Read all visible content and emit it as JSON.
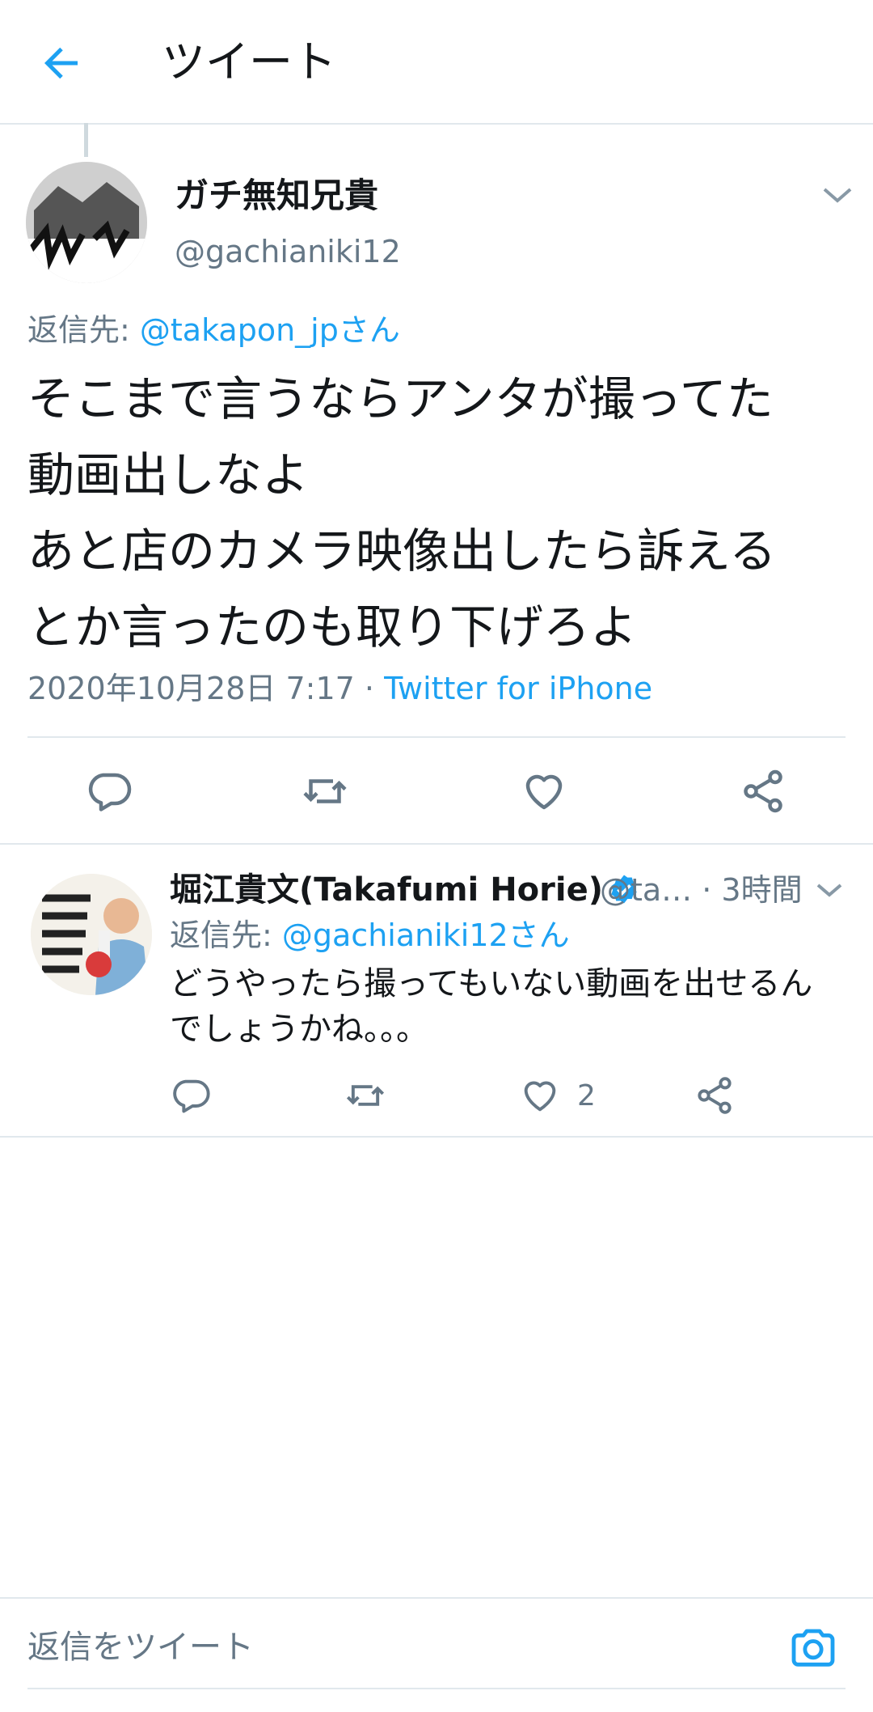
{
  "header": {
    "title": "ツイート",
    "back_icon": "arrow-left-icon"
  },
  "colors": {
    "accent": "#1da1f2",
    "muted": "#657786",
    "divider": "#e1e8ed",
    "text": "#14171a"
  },
  "main_tweet": {
    "display_name": "ガチ無知兄貴",
    "handle": "@gachianiki12",
    "reply_to_label": "返信先: ",
    "reply_to_handle": "@takapon_jpさん",
    "body_lines": [
      "そこまで言うならアンタが撮ってた",
      "動画出しなよ",
      "あと店のカメラ映像出したら訴える",
      "とか言ったのも取り下げろよ"
    ],
    "timestamp": "2020年10月28日 7:17 · ",
    "source": "Twitter for iPhone"
  },
  "reply_tweet": {
    "display_name": "堀江貴文(Takafumi Horie)",
    "handle_time": "@ta… · 3時間",
    "reply_to_label": "返信先: ",
    "reply_to_handle": "@gachianiki12さん",
    "body": "どうやったら撮ってもいない動画を出せるんでしょうかね。。。",
    "like_count": "2"
  },
  "composer": {
    "placeholder": "返信をツイート",
    "camera_icon": "camera-icon"
  }
}
